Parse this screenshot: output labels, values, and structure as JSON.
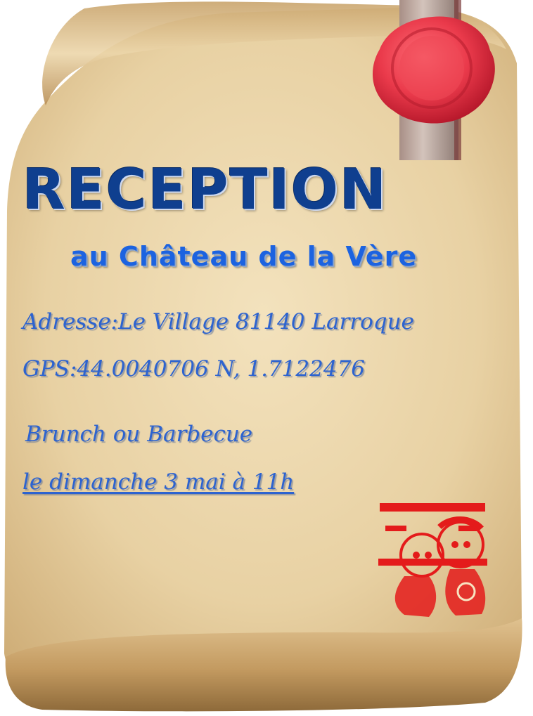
{
  "invitation": {
    "title": "RECEPTION",
    "subtitle": "au Château de la Vère",
    "address": "Adresse:Le Village 81140 Larroque",
    "gps": "GPS:44.0040706 N, 1.7122476",
    "event": "Brunch ou Barbecue",
    "date": "le dimanche 3 mai à 11h"
  },
  "colors": {
    "parchment": "#e9d3a6",
    "title_blue": "#0f3f8f",
    "subtitle_blue": "#1c63e0",
    "script_blue": "#2d63cf",
    "wax_seal": "#e8384a",
    "ribbon": "#b8a6a0",
    "papercut_red": "#e41b1b"
  },
  "images": {
    "seal": "wax-seal-icon",
    "papercut": "double-happiness-couple-papercut-icon"
  }
}
